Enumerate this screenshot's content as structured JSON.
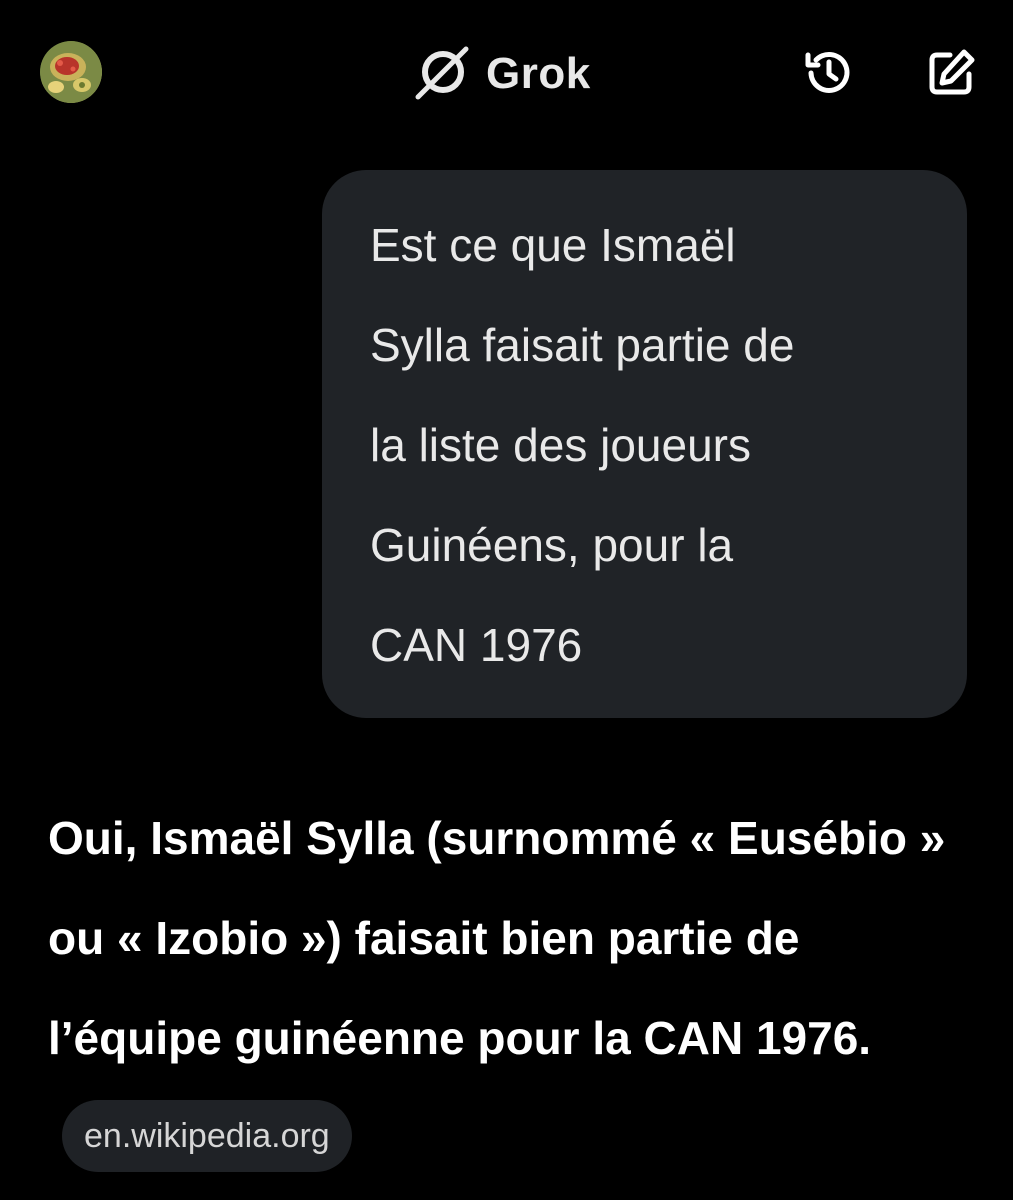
{
  "header": {
    "title": "Grok",
    "logo_icon": "grok-logo-icon",
    "history_icon": "history-icon",
    "new_chat_icon": "edit-icon"
  },
  "conversation": {
    "user_message": "Est ce que Ismaël\nSylla faisait partie de\nla liste des joueurs\nGuinéens, pour la\nCAN 1976",
    "assistant_message": "Oui, Ismaël Sylla (surnommé « Eusébio » ou « Izobio ») faisait bien partie de l’équipe guinéenne pour la CAN 1976.",
    "source_chip": "en.wikipedia.org"
  },
  "colors": {
    "background": "#000000",
    "user_bubble": "#202327",
    "source_chip": "#1f2226",
    "text": "#ffffff"
  }
}
